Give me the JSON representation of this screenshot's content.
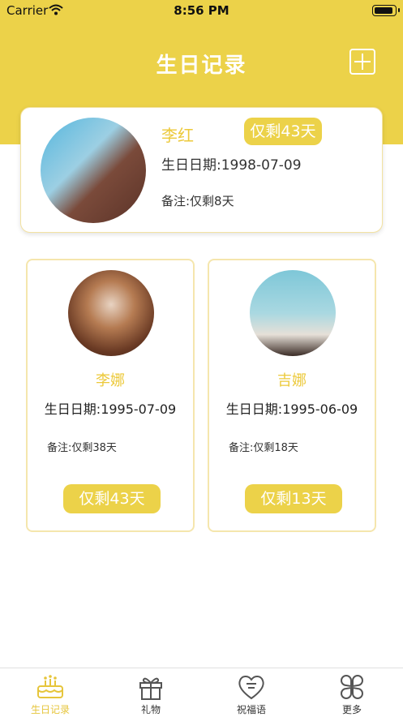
{
  "status_bar": {
    "carrier": "Carrier",
    "time": "8:56 PM"
  },
  "header": {
    "title": "生日记录",
    "add_icon": "plus-square-icon"
  },
  "featured": {
    "name": "李红",
    "badge": "仅剩43天",
    "date": "生日日期:1998-07-09",
    "note": "备注:仅剩8天"
  },
  "cards": [
    {
      "name": "李娜",
      "date": "生日日期:1995-07-09",
      "note": "备注:仅剩38天",
      "badge": "仅剩43天"
    },
    {
      "name": "吉娜",
      "date": "生日日期:1995-06-09",
      "note": "备注:仅剩18天",
      "badge": "仅剩13天"
    }
  ],
  "tabs": [
    {
      "label": "生日记录",
      "icon": "cake-icon",
      "active": true
    },
    {
      "label": "礼物",
      "icon": "gift-icon",
      "active": false
    },
    {
      "label": "祝福语",
      "icon": "heart-message-icon",
      "active": false
    },
    {
      "label": "更多",
      "icon": "clover-grid-icon",
      "active": false
    }
  ],
  "colors": {
    "accent": "#ecd249",
    "name_text": "#ecc93a",
    "tab_active": "#e6c53b"
  }
}
